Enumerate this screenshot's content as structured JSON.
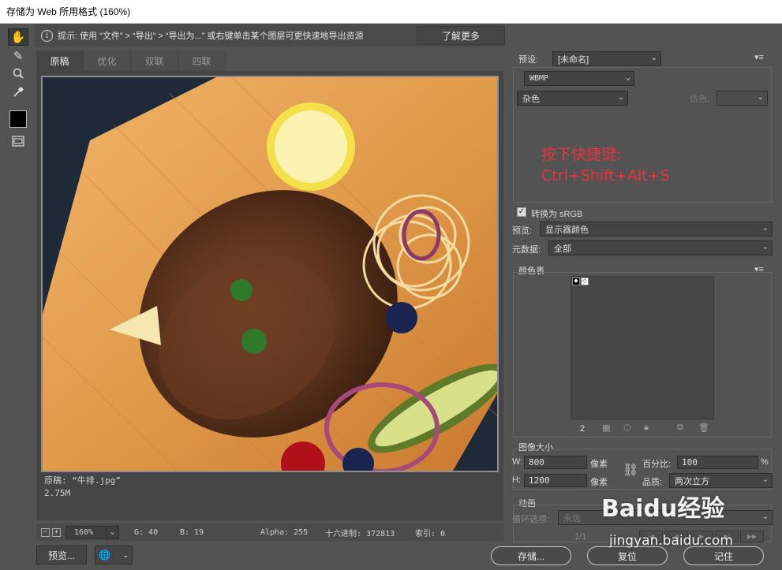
{
  "window": {
    "title": "存储为 Web 所用格式 (160%)"
  },
  "toolbar": {
    "tools": [
      "hand-icon",
      "slice-select-icon",
      "zoom-icon",
      "eyedropper-icon"
    ]
  },
  "hint": {
    "text": "提示: 使用 “文件” > “导出” > “导出为...” 或右键单击某个图层可更快速地导出资源",
    "learn_more": "了解更多"
  },
  "tabs": [
    "原稿",
    "优化",
    "双联",
    "四联"
  ],
  "image": {
    "caption_line1": "原稿: “牛排.jpg”",
    "caption_line2": "2.75M"
  },
  "status": {
    "zoom": "160%",
    "g": "G: 40",
    "b": "B: 19",
    "alpha": "Alpha: 255",
    "hex": "十六进制: 372813",
    "index": "索引: 0"
  },
  "buttons": {
    "preview": "预览...",
    "save": "存储...",
    "reset": "复位",
    "remember": "记住"
  },
  "settings": {
    "preset_label": "预设:",
    "preset_value": "[未命名]",
    "format": "WBMP",
    "dither": "杂色",
    "dither_label": "仿色:",
    "convert_srgb": "转换为 sRGB",
    "preview_label": "预览:",
    "preview_value": "显示器颜色",
    "metadata_label": "元数据:",
    "metadata_value": "全部"
  },
  "annotation": {
    "line1": "按下快捷键:",
    "line2": "Ctrl+Shift+Alt+S"
  },
  "color_table": {
    "title": "颜色表",
    "count": "2"
  },
  "image_size": {
    "title": "图像大小",
    "w_label": "W:",
    "w_value": "800",
    "h_label": "H:",
    "h_value": "1200",
    "unit": "像素",
    "percent_label": "百分比:",
    "percent_value": "100",
    "percent_unit": "%",
    "quality_label": "品质:",
    "quality_value": "两次立方"
  },
  "animation": {
    "title": "动画",
    "loop_label": "循环选项:",
    "loop_value": "永远",
    "frame": "1/1"
  },
  "watermark": {
    "brand": "Baidu经验",
    "url": "jingyan.baidu.com"
  }
}
